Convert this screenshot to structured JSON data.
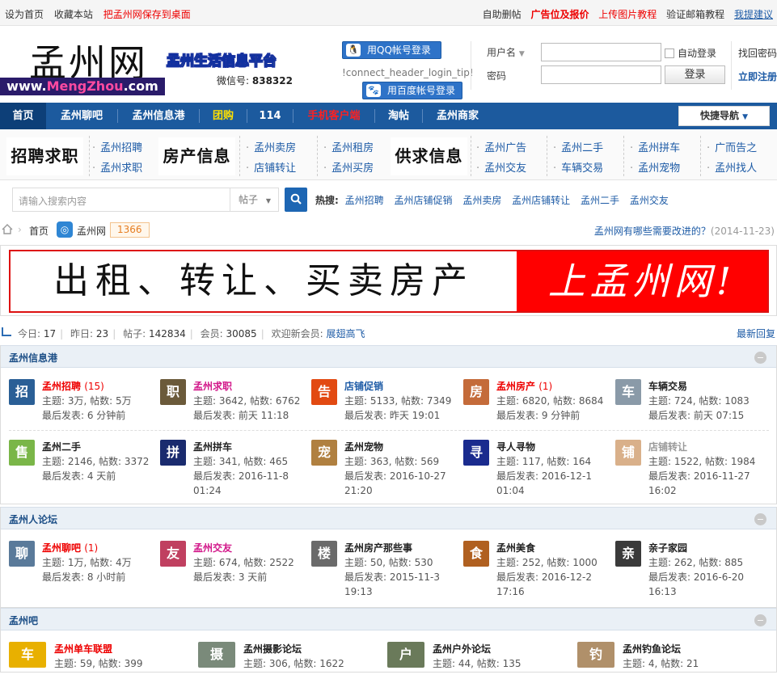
{
  "topbar": {
    "left": [
      "设为首页",
      "收藏本站",
      "把孟州网保存到桌面"
    ],
    "right": [
      "自助删帖",
      "广告位及报价",
      "上传图片教程",
      "验证邮箱教程",
      "我提建议"
    ]
  },
  "header": {
    "logo_cn": "孟州网",
    "logo_url_a": "www.",
    "logo_url_b": "MengZhou",
    "logo_url_c": ".com",
    "slogan": "孟州生活信息平台",
    "wechat_label": "微信号:",
    "wechat_value": "838322",
    "qq_login": "用QQ帐号登录",
    "login_hint": "!connect_header_login_tip!",
    "baidu_login": "用百度帐号登录"
  },
  "login": {
    "username_label": "用户名",
    "password_label": "密码",
    "auto_login": "自动登录",
    "login_button": "登录",
    "find_password": "找回密码",
    "register": "立即注册"
  },
  "nav": {
    "items": [
      "首页",
      "孟州聊吧",
      "孟州信息港",
      "团购",
      "114",
      "手机客户端",
      "淘帖",
      "孟州商家"
    ],
    "quick_nav": "快捷导航"
  },
  "categories": {
    "groups": [
      "招聘求职",
      "房产信息",
      "供求信息"
    ],
    "links": [
      "孟州招聘",
      "孟州求职",
      "孟州卖房",
      "店铺转让",
      "孟州租房",
      "孟州买房",
      "孟州广告",
      "孟州交友",
      "孟州二手",
      "车辆交易",
      "孟州拼车",
      "孟州宠物",
      "广而告之",
      "孟州找人"
    ]
  },
  "search": {
    "placeholder": "请输入搜索内容",
    "type": "帖子",
    "hot_label": "热搜:",
    "hot": [
      "孟州招聘",
      "孟州店铺促销",
      "孟州卖房",
      "孟州店铺转让",
      "孟州二手",
      "孟州交友"
    ]
  },
  "breadcrumb": {
    "home": "首页",
    "site": "孟州网",
    "count": "1366",
    "notice": "孟州网有哪些需要改进的？",
    "notice_date": "(2014-11-23)"
  },
  "banner": {
    "left": "出租、转让、买卖房产",
    "right": "上孟州网!"
  },
  "stats": {
    "today_label": "今日:",
    "today": "17",
    "yesterday_label": "昨日:",
    "yesterday": "23",
    "posts_label": "帖子:",
    "posts": "142834",
    "members_label": "会员:",
    "members": "30085",
    "newest_label": "欢迎新会员:",
    "newest": "展翅高飞",
    "latest": "最新回复"
  },
  "sections": [
    {
      "title": "孟州信息港",
      "forums": [
        {
          "name": "孟州招聘",
          "new": "(15)",
          "stat": "主题: 3万, 帖数: 5万",
          "last": "最后发表: 6 分钟前",
          "color": "#2a5f96",
          "icon": "招"
        },
        {
          "name": "孟州求职",
          "new": "",
          "stat": "主题: 3642, 帖数: 6762",
          "last": "最后发表: 前天 11:18",
          "color": "#6b5a3a",
          "icon": "职"
        },
        {
          "name": "店铺促销",
          "new": "",
          "stat": "主题: 5133, 帖数: 7349",
          "last": "最后发表: 昨天 19:01",
          "color": "#e24a12",
          "icon": "告"
        },
        {
          "name": "孟州房产",
          "new": "(1)",
          "stat": "主题: 6820, 帖数: 8684",
          "last": "最后发表: 9 分钟前",
          "color": "#c46b3a",
          "icon": "房"
        },
        {
          "name": "车辆交易",
          "new": "",
          "stat": "主题: 724, 帖数: 1083",
          "last": "最后发表: 前天 07:15",
          "color": "#8a9aa8",
          "icon": "车"
        },
        {
          "name": "孟州二手",
          "new": "",
          "stat": "主题: 2146, 帖数: 3372",
          "last": "最后发表: 4 天前",
          "color": "#7ab648",
          "icon": "售"
        },
        {
          "name": "孟州拼车",
          "new": "",
          "stat": "主题: 341, 帖数: 465",
          "last": "最后发表: 2016-11-8 01:24",
          "color": "#1a2b6e",
          "icon": "拼"
        },
        {
          "name": "孟州宠物",
          "new": "",
          "stat": "主题: 363, 帖数: 569",
          "last": "最后发表: 2016-10-27 21:20",
          "color": "#b08040",
          "icon": "宠"
        },
        {
          "name": "寻人寻物",
          "new": "",
          "stat": "主题: 117, 帖数: 164",
          "last": "最后发表: 2016-12-1 01:04",
          "color": "#1a2b8e",
          "icon": "寻"
        },
        {
          "name": "店铺转让",
          "new": "",
          "stat": "主题: 1522, 帖数: 1984",
          "last": "最后发表: 2016-11-27 16:02",
          "color": "#d9b08a",
          "icon": "铺"
        }
      ]
    },
    {
      "title": "孟州人论坛",
      "forums": [
        {
          "name": "孟州聊吧",
          "new": "(1)",
          "stat": "主题: 1万, 帖数: 4万",
          "last": "最后发表: 8 小时前",
          "color": "#5a7a9a",
          "icon": "聊"
        },
        {
          "name": "孟州交友",
          "new": "",
          "stat": "主题: 674, 帖数: 2522",
          "last": "最后发表: 3 天前",
          "color": "#c04060",
          "icon": "友"
        },
        {
          "name": "孟州房产那些事",
          "new": "",
          "stat": "主题: 50, 帖数: 530",
          "last": "最后发表: 2015-11-3 19:13",
          "color": "#6a6a6a",
          "icon": "楼"
        },
        {
          "name": "孟州美食",
          "new": "",
          "stat": "主题: 252, 帖数: 1000",
          "last": "最后发表: 2016-12-2 17:16",
          "color": "#b06020",
          "icon": "食"
        },
        {
          "name": "亲子家园",
          "new": "",
          "stat": "主题: 262, 帖数: 885",
          "last": "最后发表: 2016-6-20 16:13",
          "color": "#3a3a3a",
          "icon": "亲"
        }
      ]
    },
    {
      "title": "孟州吧",
      "forums": [
        {
          "name": "孟州单车联盟",
          "new": "",
          "stat": "主题: 59, 帖数: 399",
          "last": "",
          "color": "#e8b000",
          "icon": "车"
        },
        {
          "name": "孟州摄影论坛",
          "new": "",
          "stat": "主题: 306, 帖数: 1622",
          "last": "",
          "color": "#7a8a7a",
          "icon": "摄"
        },
        {
          "name": "孟州户外论坛",
          "new": "",
          "stat": "主题: 44, 帖数: 135",
          "last": "",
          "color": "#6a7a5a",
          "icon": "户"
        },
        {
          "name": "孟州钓鱼论坛",
          "new": "",
          "stat": "主题: 4, 帖数: 21",
          "last": "",
          "color": "#b0906a",
          "icon": "钓"
        }
      ]
    }
  ]
}
